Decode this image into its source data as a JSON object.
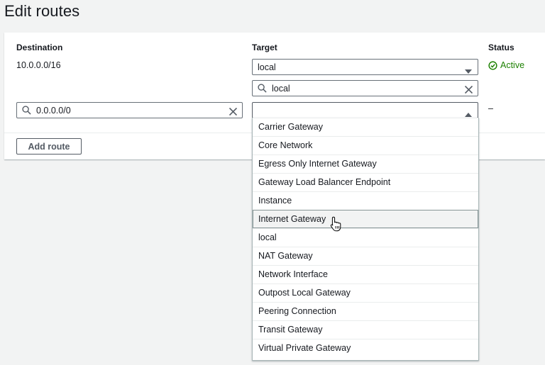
{
  "page": {
    "title": "Edit routes"
  },
  "table": {
    "headers": {
      "destination": "Destination",
      "target": "Target",
      "status": "Status"
    },
    "rows": [
      {
        "destination": "10.0.0.0/16",
        "target": "local",
        "target_filter": "local",
        "status": "Active"
      },
      {
        "destination": "0.0.0.0/0",
        "target": "",
        "status": "–"
      }
    ]
  },
  "buttons": {
    "add_route": "Add route"
  },
  "dropdown": {
    "options": [
      "Carrier Gateway",
      "Core Network",
      "Egress Only Internet Gateway",
      "Gateway Load Balancer Endpoint",
      "Instance",
      "Internet Gateway",
      "local",
      "NAT Gateway",
      "Network Interface",
      "Outpost Local Gateway",
      "Peering Connection",
      "Transit Gateway",
      "Virtual Private Gateway"
    ],
    "hovered": "Internet Gateway"
  },
  "colors": {
    "success": "#1d8102",
    "border": "#687078",
    "text": "#16191f"
  },
  "icons": {
    "search": "search-icon",
    "clear": "close-icon",
    "caret_down": "caret-down-icon",
    "caret_up": "caret-up-icon",
    "status": "status-success-icon",
    "cursor": "hand-pointer-icon"
  }
}
